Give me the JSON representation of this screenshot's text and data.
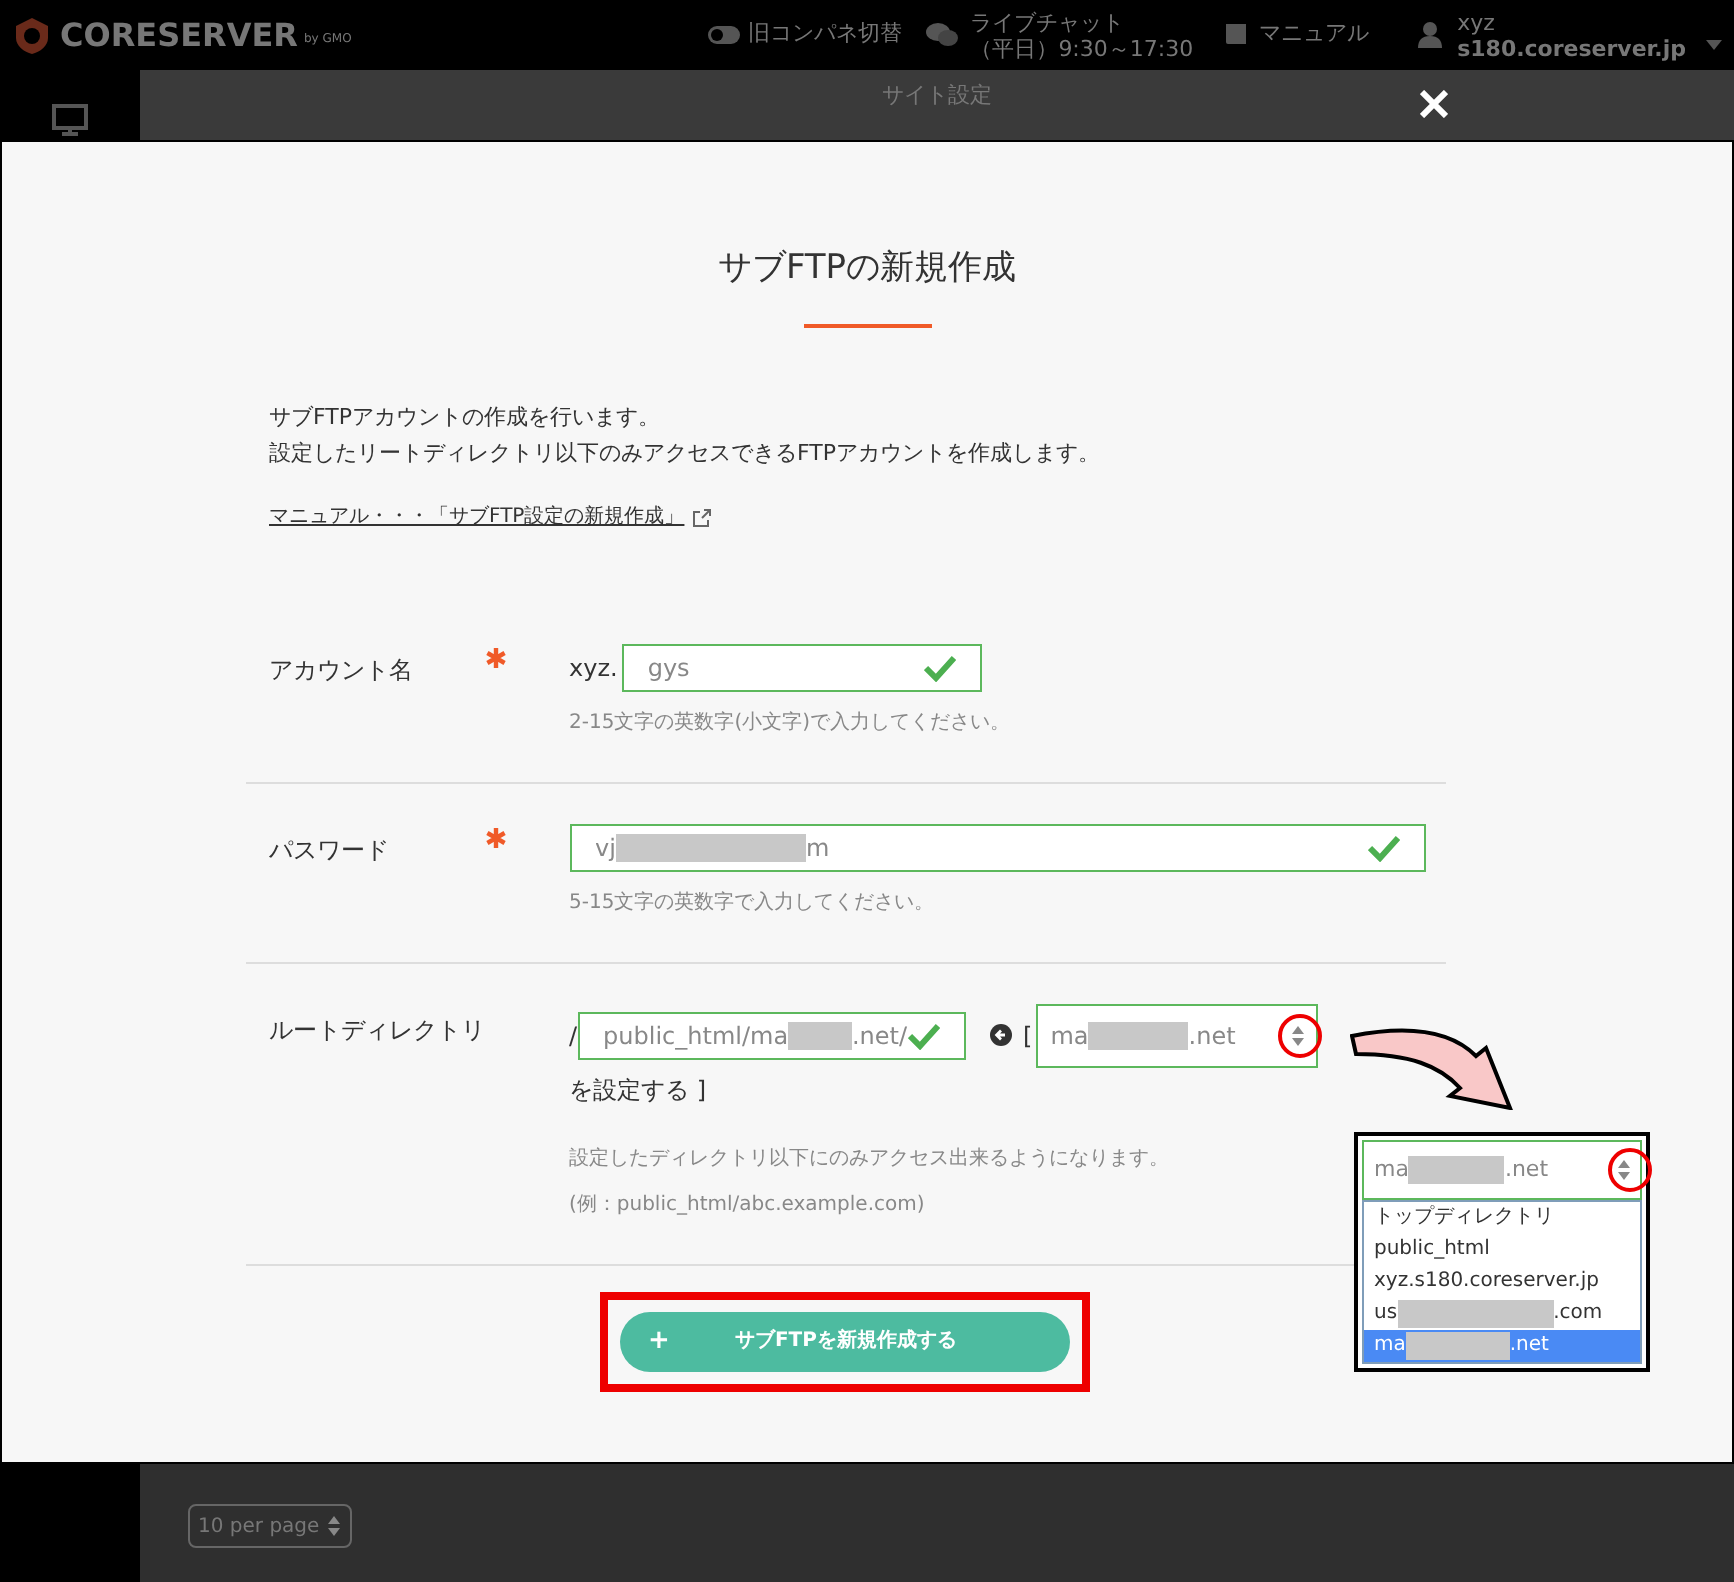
{
  "header": {
    "logo": "CORESERVER",
    "logo_suffix": "by GMO",
    "toggle_label": "旧コンパネ切替",
    "chat": {
      "label": "ライブチャット",
      "hours": "（平日）9:30～17:30"
    },
    "manual": "マニュアル",
    "user": {
      "name": "xyz",
      "server": "s180.coreserver.jp"
    }
  },
  "background": {
    "title": "サイト設定",
    "per_page": "10 per page"
  },
  "modal": {
    "title": "サブFTPの新規作成",
    "intro": [
      "サブFTPアカウントの作成を行います。",
      "設定したリートディレクトリ以下のみアクセスできるFTPアカウントを作成します。"
    ],
    "manual_link": "マニュアル・・・「サブFTP設定の新規作成」",
    "fields": [
      {
        "kind": "account",
        "label": "アカウント名",
        "required": true,
        "prefix": "xyz.",
        "value_parts": [
          "gys"
        ],
        "valid": true,
        "hint": "2-15文字の英数字(小文字)で入力してください。"
      },
      {
        "kind": "password",
        "label": "パスワード",
        "required": true,
        "value_parts": [
          "vj",
          "m"
        ],
        "valid": true,
        "hint": "5-15文字の英数字で入力してください。"
      },
      {
        "kind": "root",
        "label": "ルートディレクトリ",
        "required": false,
        "slash": "/",
        "value_parts": [
          "public_html/ma",
          ".net/"
        ],
        "valid": true,
        "bracket": "[",
        "domain_parts": [
          "ma",
          ".net"
        ],
        "suffix": "を設定する ]",
        "hints": [
          "設定したディレクトリ以下にのみアクセス出来るようになります。",
          "(例：public_html/abc.example.com)"
        ]
      }
    ],
    "submit": {
      "icon": "+",
      "label": "サブFTPを新規作成する"
    }
  },
  "callout": {
    "value_parts": [
      "ma",
      ".net"
    ],
    "options": [
      {
        "parts": [
          "トップディレクトリ"
        ],
        "selected": false
      },
      {
        "parts": [
          "public_html"
        ],
        "selected": false
      },
      {
        "parts": [
          "xyz.s180.coreserver.jp"
        ],
        "selected": false
      },
      {
        "parts": [
          "us",
          ".com"
        ],
        "selected": false
      },
      {
        "parts": [
          "ma",
          ".net"
        ],
        "selected": true
      }
    ]
  }
}
